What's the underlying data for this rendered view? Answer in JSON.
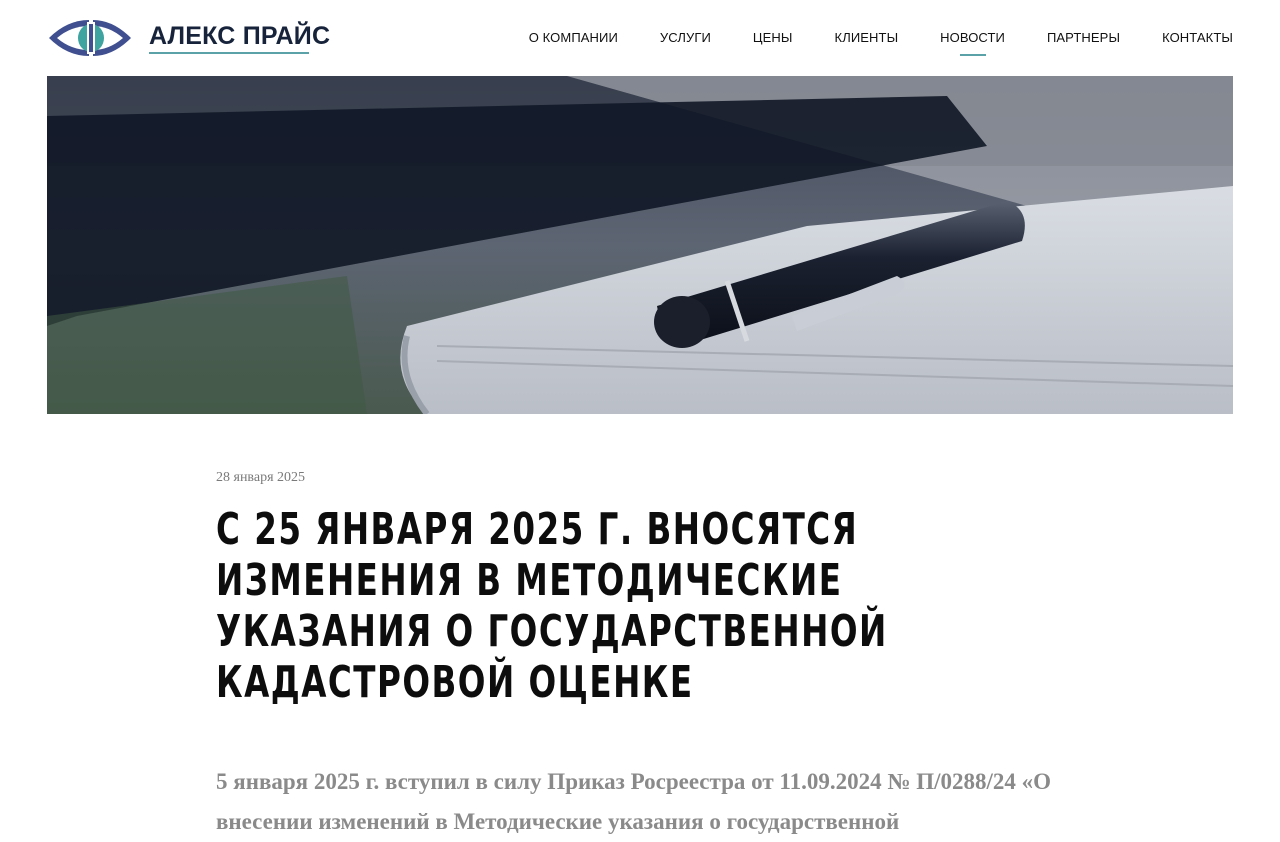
{
  "brand": {
    "name": "АЛЕКС ПРАЙС",
    "colors": {
      "accent": "#5ba2a8",
      "logo_blue": "#3f4f8f",
      "logo_teal": "#3fa39f",
      "text": "#16233a"
    }
  },
  "nav": {
    "items": [
      {
        "label": "О КОМПАНИИ"
      },
      {
        "label": "УСЛУГИ"
      },
      {
        "label": "ЦЕНЫ"
      },
      {
        "label": "КЛИЕНТЫ"
      },
      {
        "label": "НОВОСТИ",
        "active": true
      },
      {
        "label": "ПАРТНЕРЫ"
      },
      {
        "label": "КОНТАКТЫ"
      }
    ]
  },
  "hero": {
    "image": "pen-on-notebook-photo"
  },
  "article": {
    "date": "28 января 2025",
    "title": "С 25 января 2025 г. вносятся изменения в Методические указания о государственной кадастровой оценке",
    "lead": "5 января 2025 г. вступил в силу Приказ Росреестра от 11.09.2024 № П/0288/24 «О внесении изменений в Методические указания о государственной"
  }
}
